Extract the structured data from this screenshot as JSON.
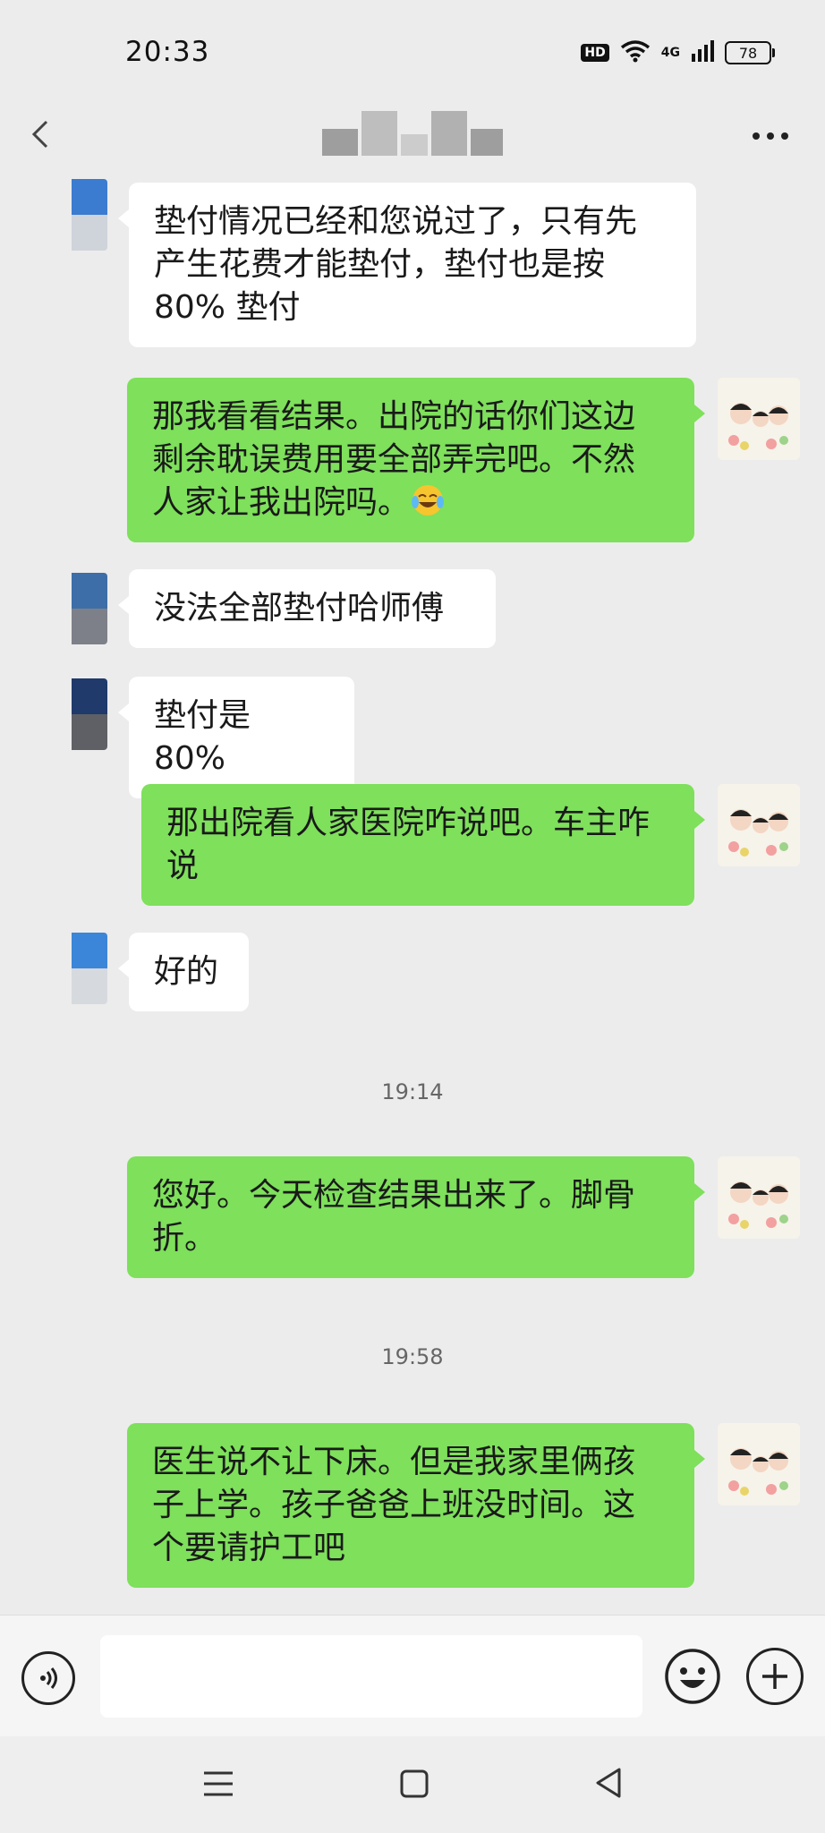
{
  "status_bar": {
    "time": "20:33",
    "hd_badge": "HD",
    "network": "4G",
    "battery": "78"
  },
  "nav": {
    "back_icon": "chevron-left-icon",
    "more_icon": "ellipsis-icon"
  },
  "messages": [
    {
      "side": "left",
      "lines": [
        "垫付情况已经和您说过了，只有先",
        "产生花费才能垫付，垫付也是按",
        "80% 垫付"
      ]
    },
    {
      "side": "right",
      "lines": [
        "那我看看结果。出院的话你们这边",
        "剩余耽误费用要全部弄完吧。不然",
        "人家让我出院吗。"
      ],
      "emoji": "laughing-crying-emoji"
    },
    {
      "side": "left",
      "lines": [
        "没法全部垫付哈师傅"
      ]
    },
    {
      "side": "left",
      "lines": [
        "垫付是 80%"
      ]
    },
    {
      "side": "right",
      "lines": [
        "那出院看人家医院咋说吧。车主咋",
        "说"
      ]
    },
    {
      "side": "left",
      "lines": [
        "好的"
      ]
    },
    {
      "timestamp": "19:14"
    },
    {
      "side": "right",
      "lines": [
        "您好。今天检查结果出来了。脚骨",
        "折。"
      ]
    },
    {
      "timestamp": "19:58"
    },
    {
      "side": "right",
      "lines": [
        "医生说不让下床。但是我家里俩孩",
        "子上学。孩子爸爸上班没时间。这",
        "个要请护工吧"
      ]
    }
  ],
  "input_bar": {
    "voice_icon": "voice-icon",
    "text_value": "",
    "emoji_icon": "smiley-icon",
    "plus_icon": "plus-icon"
  },
  "system_nav": {
    "menu_icon": "menu-icon",
    "home_icon": "home-square-icon",
    "back_icon": "back-triangle-icon"
  },
  "colors": {
    "background": "#ececec",
    "bubble_sent": "#7ee05b",
    "bubble_received": "#ffffff"
  }
}
